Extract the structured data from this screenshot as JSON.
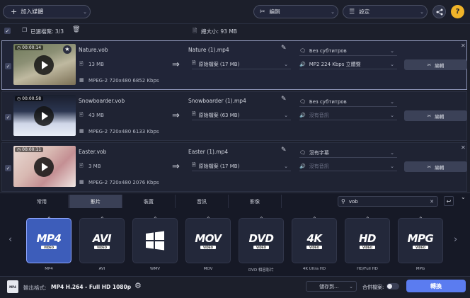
{
  "toolbar": {
    "add_media_label": "加入媒體",
    "edit_label": "編輯",
    "settings_label": "設定"
  },
  "header": {
    "selected_label": "已選檔案: 3/3",
    "total_size_label": "總大小: 93 MB"
  },
  "files": [
    {
      "time": "00:00:14",
      "source_name": "Nature.vob",
      "size": "13 MB",
      "codec": "MPEG-2 720x480 6852 Kbps",
      "output_name": "Nature (1).mp4",
      "original_file": "原始檔案 (17 MB)",
      "subtitle": "Без субтитров",
      "audio": "MP2 224 Kbps 立體聲",
      "edit_label": "編輯",
      "selected": true
    },
    {
      "time": "00:00:58",
      "source_name": "Snowboarder.vob",
      "size": "43 MB",
      "codec": "MPEG-2 720x480 6133 Kbps",
      "output_name": "Snowboarder (1).mp4",
      "original_file": "原始檔案 (63 MB)",
      "subtitle": "Без субтитров",
      "audio": "沒有音訊",
      "edit_label": "編輯",
      "selected": false
    },
    {
      "time": "00:00:11",
      "source_name": "Easter.vob",
      "size": "3 MB",
      "codec": "MPEG-2 720x480 2076 Kbps",
      "output_name": "Easter (1).mp4",
      "original_file": "原始檔案 (17 MB)",
      "subtitle": "沒有字幕",
      "audio": "沒有音訊",
      "edit_label": "編輯",
      "selected": false
    }
  ],
  "tabs": [
    "常用",
    "影片",
    "裝置",
    "音訊",
    "影像"
  ],
  "active_tab": "影片",
  "search": {
    "value": "vob"
  },
  "formats": [
    {
      "logo": "MP4",
      "sub": "VIDEO",
      "label": "MP4",
      "active": true
    },
    {
      "logo": "AVI",
      "sub": "VIDEO",
      "label": "AVI",
      "active": false
    },
    {
      "logo": "",
      "sub": "",
      "label": "WMV",
      "active": false
    },
    {
      "logo": "MOV",
      "sub": "VIDEO",
      "label": "MOV",
      "active": false
    },
    {
      "logo": "DVD",
      "sub": "VIDEO",
      "label": "DVD 相容影片",
      "active": false
    },
    {
      "logo": "4K",
      "sub": "VIDEO",
      "label": "4K Ultra HD",
      "active": false
    },
    {
      "logo": "HD",
      "sub": "VIDEO",
      "label": "HD/Full HD",
      "active": false
    },
    {
      "logo": "MPG",
      "sub": "VIDEO",
      "label": "MPG",
      "active": false
    }
  ],
  "footer": {
    "output_format_label": "輸出格式:",
    "output_format_value": "MP4 H.264 - Full HD 1080p",
    "save_to_label": "儲存到...",
    "merge_label": "合併檔案:",
    "convert_label": "轉換"
  },
  "colors": {
    "background": "#1c1f2b",
    "accent": "#3d5dba",
    "convert_button": "#5b7cf0"
  }
}
